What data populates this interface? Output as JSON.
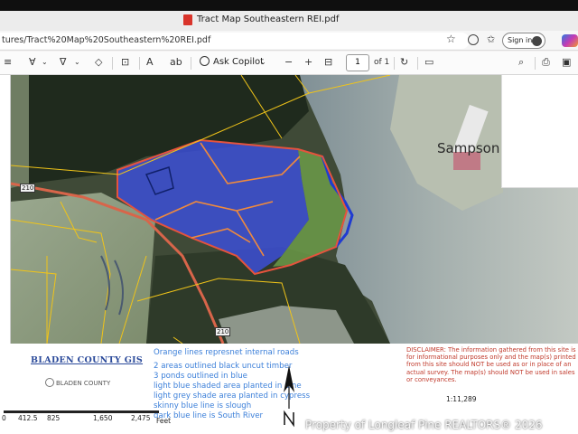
{
  "window": {
    "title": "Tract Map Southeastern REI.pdf"
  },
  "address_bar": {
    "url": "tures/Tract%20Map%20Southeastern%20REI.pdf",
    "sign_in_label": "Sign in"
  },
  "pdf_toolbar": {
    "ask_copilot_label": "Ask Copilot",
    "zoom_out": "−",
    "zoom_in": "+",
    "current_page": "1",
    "page_count_label": "of 1"
  },
  "map": {
    "county_label": "Sampson",
    "road_labels": [
      "210",
      "210"
    ]
  },
  "legend": {
    "title": "BLADEN COUNTY GIS",
    "logo_text": "BLADEN COUNTY",
    "notes": [
      "Orange lines represnet internal roads",
      "2 areas outlined black uncut timber",
      "3 ponds outlined in blue",
      "light blue shaded area planted in pine",
      "light grey shade area planted in cypress",
      "skinny blue line is slough",
      "dark blue line is South River"
    ],
    "disclaimer": "DISCLAIMER: The information gathered from this site is for informational purposes only and the map(s) printed from this site should NOT be used as or in place of an actual survey. The map(s) should NOT be used in sales or conveyances.",
    "scale_ratio": "1:11,289",
    "scale_ticks": [
      "0",
      "412.5",
      "825",
      "1,650",
      "2,475"
    ],
    "scale_unit": "Feet",
    "north_label": "N",
    "watermark": "Property of Longleaf Pine REALTORS® 2026"
  },
  "colors": {
    "accent_notes": "#3b7fd9",
    "disclaimer_red": "#c0392b",
    "gis_title_blue": "#2b4a9a",
    "parcel_outline": "#f0c419",
    "tract_outline": "#e5533d",
    "pine_area": "#3c4fd6",
    "cypress_area": "#6fa04a"
  }
}
